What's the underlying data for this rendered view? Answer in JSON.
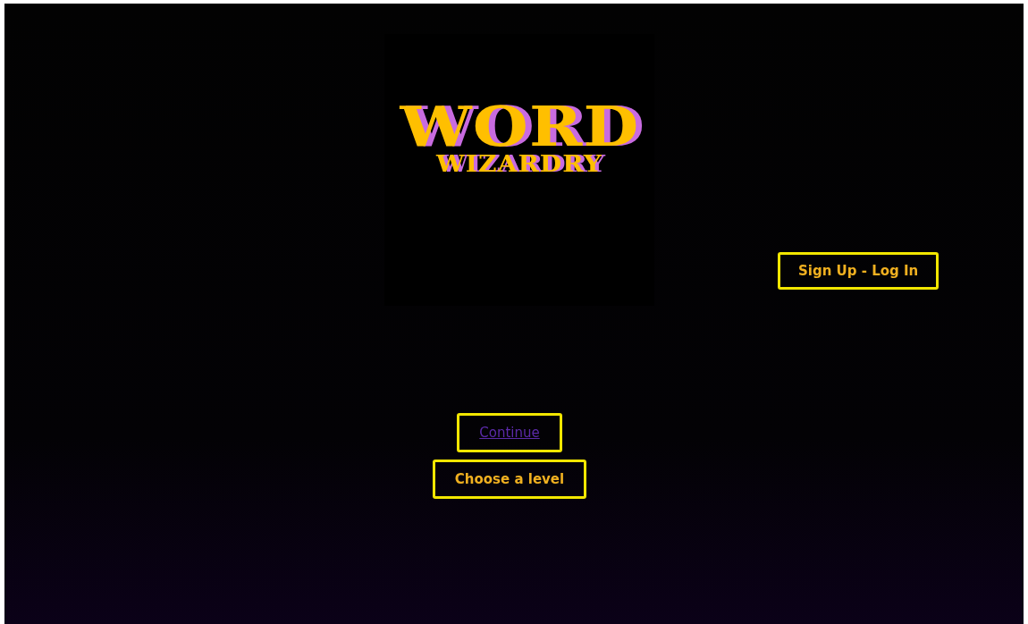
{
  "logo": {
    "line_1": "WORD",
    "line_2": "WIZARDRY"
  },
  "auth_button": {
    "label": "Sign Up - Log In"
  },
  "actions": [
    {
      "kind": "link",
      "label": "Continue"
    },
    {
      "kind": "button",
      "label": "Choose a level"
    }
  ]
}
